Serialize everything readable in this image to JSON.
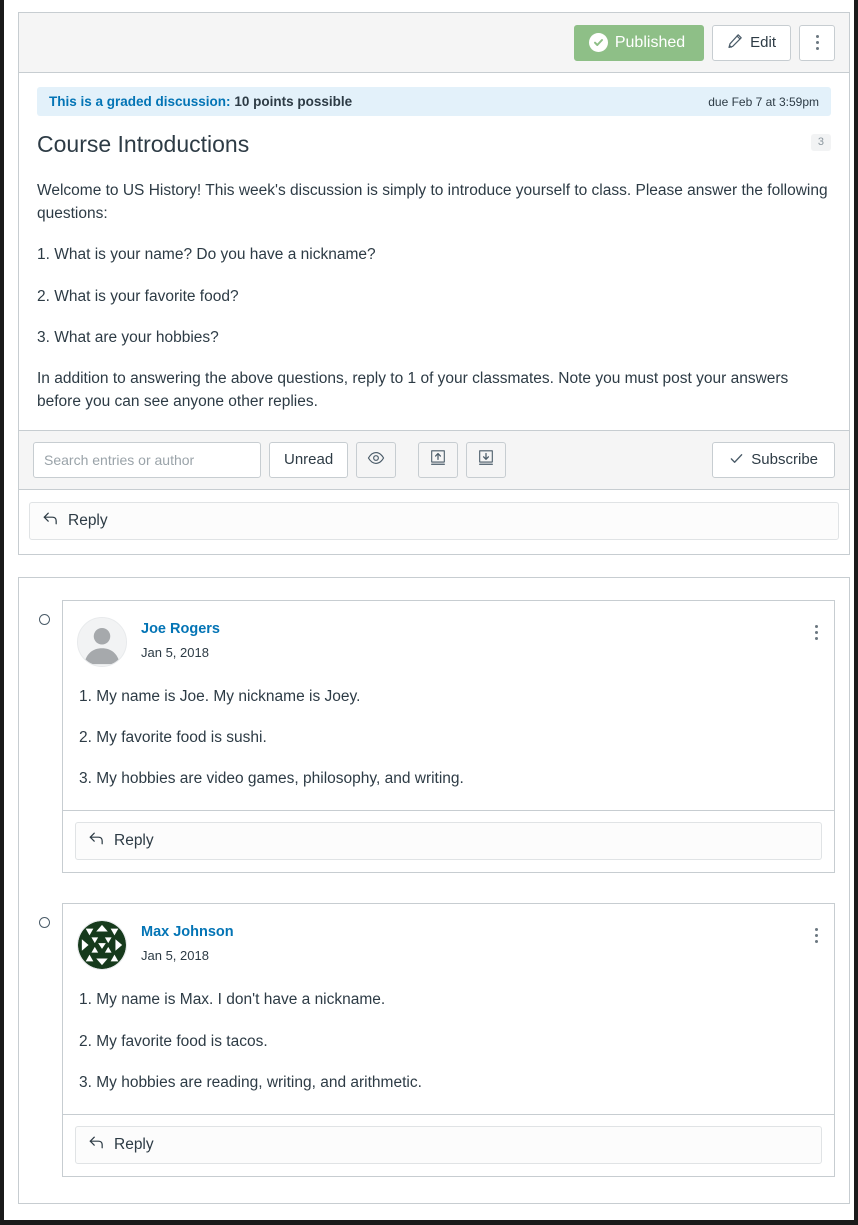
{
  "header": {
    "published_label": "Published",
    "edit_label": "Edit",
    "options_label": "Manage this discussion"
  },
  "banner": {
    "graded_label": "This is a graded discussion:",
    "points_label": "10 points possible",
    "due_label": "due Feb 7 at 3:59pm"
  },
  "discussion": {
    "title": "Course Introductions",
    "reply_count": "3",
    "paragraphs": [
      "Welcome to US History! This week's discussion is simply to introduce yourself to class. Please answer the following questions:",
      "1. What is your name? Do you have a nickname?",
      "2. What is your favorite food?",
      "3. What are your hobbies?",
      "In addition to answering the above questions, reply to 1 of your classmates. Note you must post your answers before you can see anyone other replies."
    ]
  },
  "toolbar": {
    "search_placeholder": "Search entries or author",
    "search_value": "",
    "unread_label": "Unread",
    "mark_all_read_label": "Mark all as read",
    "collapse_label": "Collapse replies",
    "expand_label": "Expand replies",
    "subscribe_label": "Subscribe"
  },
  "reply_bar": {
    "label": "Reply"
  },
  "entries": [
    {
      "author": "Joe Rogers",
      "date": "Jan 5, 2018",
      "avatar_type": "default-user-avatar",
      "unread": true,
      "paragraphs": [
        "1. My name is Joe. My nickname is Joey.",
        "2. My favorite food is sushi.",
        "3. My hobbies are video games, philosophy, and writing."
      ],
      "reply_label": "Reply"
    },
    {
      "author": "Max Johnson",
      "date": "Jan 5, 2018",
      "avatar_type": "identicon-green",
      "unread": true,
      "paragraphs": [
        "1. My name is Max. I don't have a nickname.",
        "2. My favorite food is tacos.",
        "3. My hobbies are reading, writing, and arithmetic."
      ],
      "reply_label": "Reply"
    }
  ],
  "colors": {
    "published_green": "#8ebf87",
    "link_blue": "#0374b5",
    "banner_blue_bg": "#e3f1fa",
    "text": "#2d3b45",
    "border": "#c7cdd1",
    "identicon_green": "#163a1c"
  }
}
